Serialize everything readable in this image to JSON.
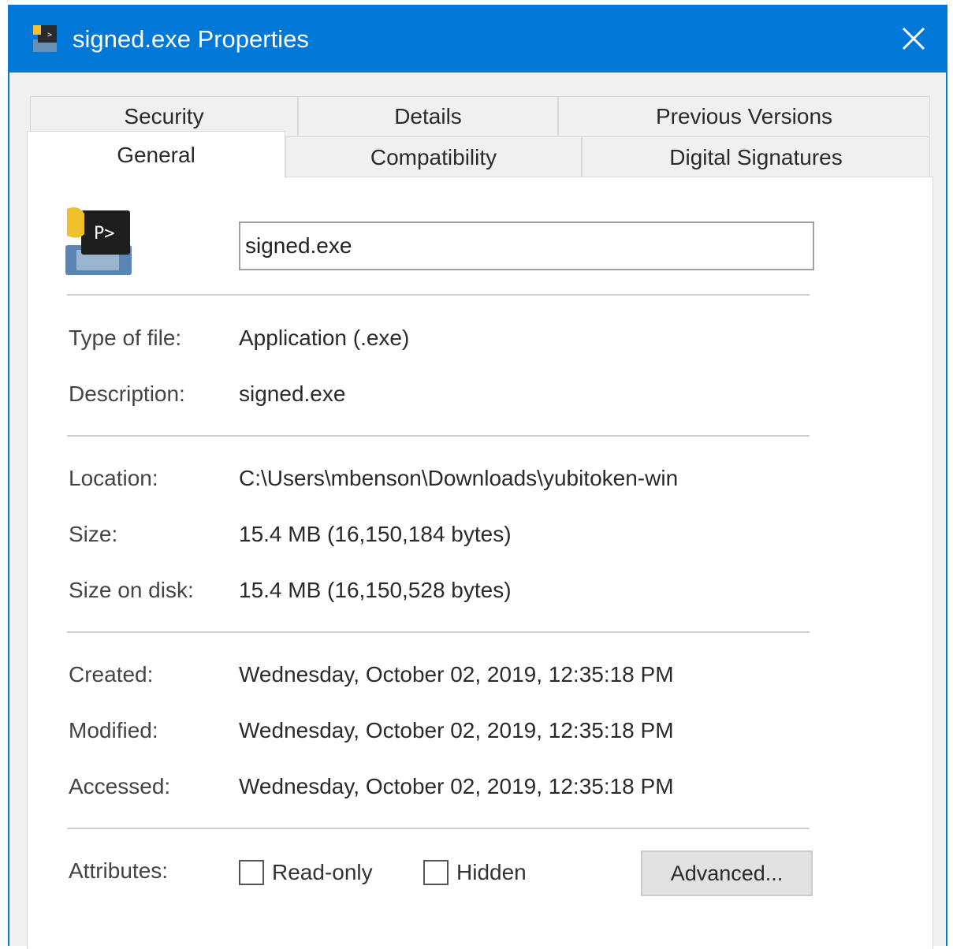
{
  "window": {
    "title": "signed.exe Properties",
    "accent_color": "#0078d7",
    "close_icon": "close-icon",
    "app_icon": "python-exe-icon"
  },
  "tabs": {
    "row1": [
      "Security",
      "Details",
      "Previous Versions"
    ],
    "row2": [
      "General",
      "Compatibility",
      "Digital Signatures"
    ],
    "active": "General"
  },
  "general": {
    "file_name": "signed.exe",
    "fields": {
      "type_label": "Type of file:",
      "type_value": "Application (.exe)",
      "description_label": "Description:",
      "description_value": "signed.exe",
      "location_label": "Location:",
      "location_value": "C:\\Users\\mbenson\\Downloads\\yubitoken-win",
      "size_label": "Size:",
      "size_value": "15.4 MB (16,150,184 bytes)",
      "size_on_disk_label": "Size on disk:",
      "size_on_disk_value": "15.4 MB (16,150,528 bytes)",
      "created_label": "Created:",
      "created_value": "Wednesday, October 02, 2019, 12:35:18 PM",
      "modified_label": "Modified:",
      "modified_value": "Wednesday, October 02, 2019, 12:35:18 PM",
      "accessed_label": "Accessed:",
      "accessed_value": "Wednesday, October 02, 2019, 12:35:18 PM"
    },
    "attributes": {
      "label": "Attributes:",
      "read_only_label": "Read-only",
      "read_only_checked": false,
      "hidden_label": "Hidden",
      "hidden_checked": false,
      "advanced_button": "Advanced..."
    }
  }
}
